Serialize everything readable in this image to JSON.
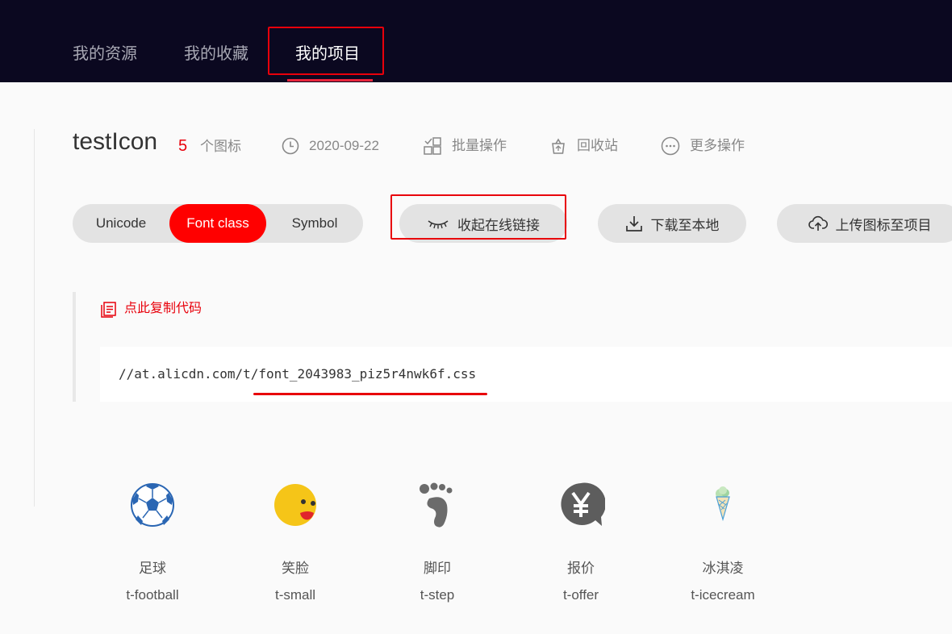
{
  "nav": {
    "tabs": [
      {
        "label": "我的资源"
      },
      {
        "label": "我的收藏"
      },
      {
        "label": "我的项目"
      }
    ],
    "active_tab": "我的项目"
  },
  "project": {
    "title": "testIcon",
    "icon_count": "5",
    "icon_count_label": "个图标",
    "date": "2020-09-22",
    "batch_label": "批量操作",
    "recycle_label": "回收站",
    "more_label": "更多操作"
  },
  "mode_switch": {
    "options": [
      "Unicode",
      "Font class",
      "Symbol"
    ],
    "selected": "Font class"
  },
  "actions": {
    "collapse_label": "收起在线链接",
    "download_label": "下载至本地",
    "upload_label": "上传图标至项目"
  },
  "code": {
    "copy_label": "点此复制代码",
    "url": "//at.alicdn.com/t/font_2043983_piz5r4nwk6f.css"
  },
  "icons": [
    {
      "name": "足球",
      "class": "t-football",
      "icon": "football-icon"
    },
    {
      "name": "笑脸",
      "class": "t-small",
      "icon": "smile-icon"
    },
    {
      "name": "脚印",
      "class": "t-step",
      "icon": "footprint-icon"
    },
    {
      "name": "报价",
      "class": "t-offer",
      "icon": "yen-offer-icon"
    },
    {
      "name": "冰淇凌",
      "class": "t-icecream",
      "icon": "icecream-icon"
    }
  ],
  "colors": {
    "nav_bg": "#0b0820",
    "accent_red": "#ff0000",
    "highlight_red": "#e8000b"
  }
}
